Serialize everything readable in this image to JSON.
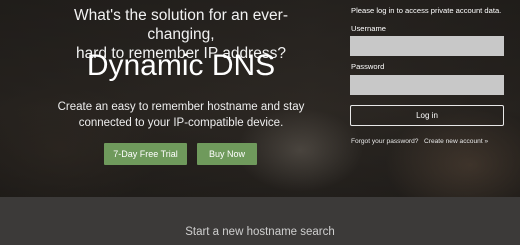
{
  "hero": {
    "headline_line1": "What's the solution for an ever-changing,",
    "headline_line2": "hard to remember IP address?",
    "product_title": "Dynamic DNS",
    "tagline_line1": "Create an easy to remember hostname and stay",
    "tagline_line2": "connected to your IP-compatible device.",
    "trial_button": "7-Day Free Trial",
    "buy_button": "Buy Now"
  },
  "login": {
    "note": "Please log in to access private account data.",
    "username_label": "Username",
    "username_value": "",
    "password_label": "Password",
    "password_value": "",
    "login_button": "Log in",
    "forgot_link": "Forgot your password?",
    "create_link": "Create new account »"
  },
  "search": {
    "title": "Start a new hostname search"
  },
  "colors": {
    "button_green": "#6f9a5c",
    "field_bg": "#c8c8c8",
    "band_bg": "#3c3a39"
  }
}
